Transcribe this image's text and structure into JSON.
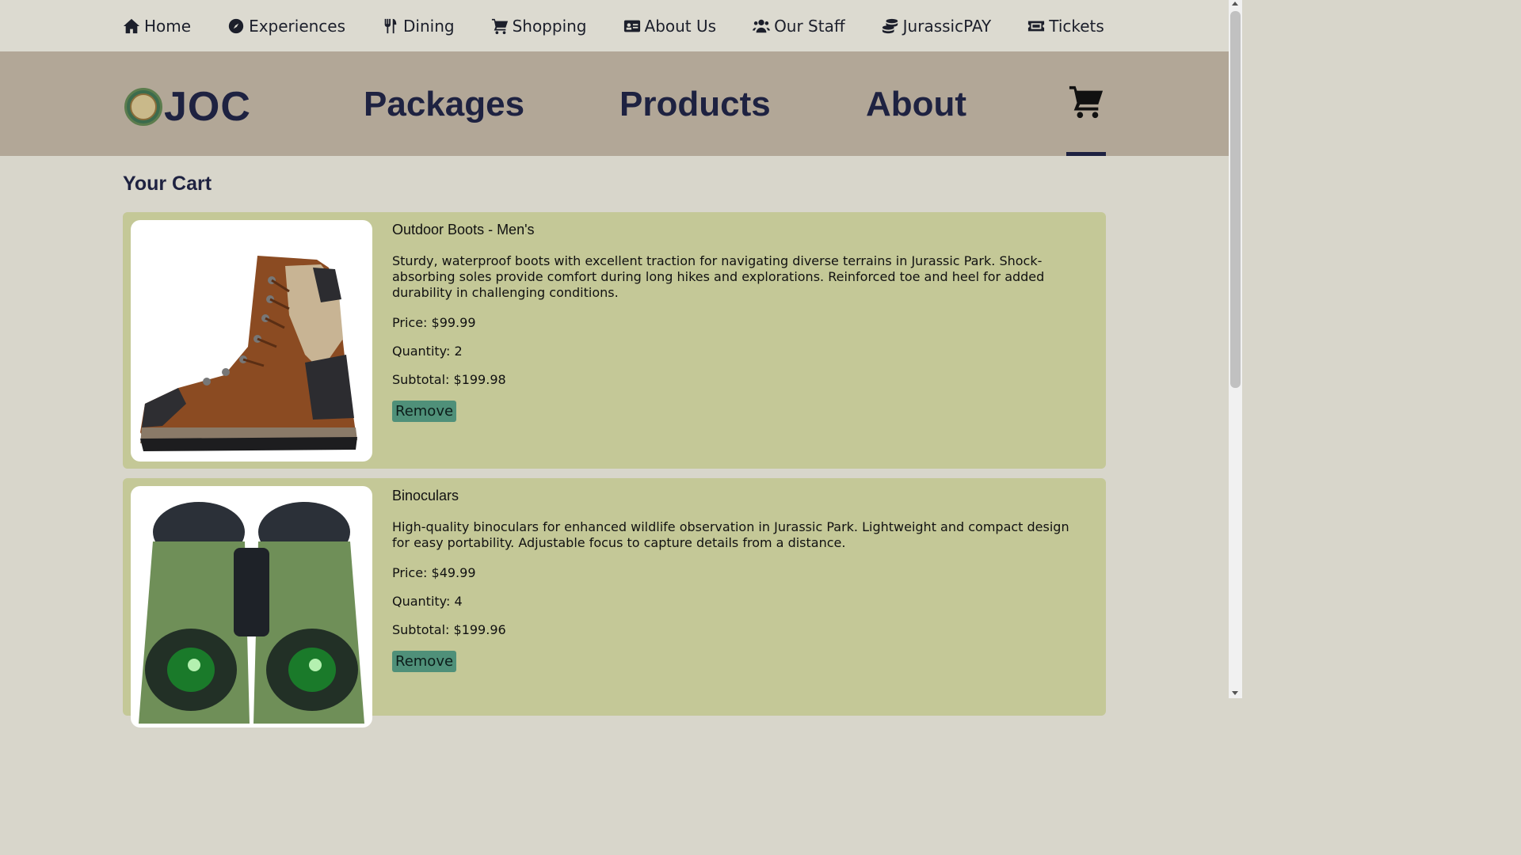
{
  "topnav": {
    "items": [
      {
        "label": "Home",
        "icon": "home-icon"
      },
      {
        "label": "Experiences",
        "icon": "compass-icon"
      },
      {
        "label": "Dining",
        "icon": "utensils-icon"
      },
      {
        "label": "Shopping",
        "icon": "cart-icon"
      },
      {
        "label": "About Us",
        "icon": "id-card-icon"
      },
      {
        "label": "Our Staff",
        "icon": "users-icon"
      },
      {
        "label": "JurassicPAY",
        "icon": "coins-icon"
      },
      {
        "label": "Tickets",
        "icon": "ticket-icon"
      }
    ]
  },
  "mainnav": {
    "brand": "JOC",
    "links": [
      "Packages",
      "Products",
      "About"
    ],
    "cart_icon": "shopping-cart-icon"
  },
  "page": {
    "title": "Your Cart"
  },
  "cart": {
    "items": [
      {
        "name": "Outdoor Boots - Men's",
        "description": "Sturdy, waterproof boots with excellent traction for navigating diverse terrains in Jurassic Park. Shock-absorbing soles provide comfort during long hikes and explorations. Reinforced toe and heel for added durability in challenging conditions.",
        "price": "Price: $99.99",
        "quantity": "Quantity: 2",
        "subtotal": "Subtotal: $199.98",
        "remove_label": "Remove"
      },
      {
        "name": "Binoculars",
        "description": "High-quality binoculars for enhanced wildlife observation in Jurassic Park. Lightweight and compact design for easy portability. Adjustable focus to capture details from a distance.",
        "price": "Price: $49.99",
        "quantity": "Quantity: 4",
        "subtotal": "Subtotal: $199.96",
        "remove_label": "Remove"
      }
    ]
  },
  "colors": {
    "topnav_bg": "#dcdad0",
    "mainnav_bg": "#b2a797",
    "card_bg": "#c4c897",
    "button_bg": "#4f9079",
    "brand_text": "#1e2241"
  }
}
